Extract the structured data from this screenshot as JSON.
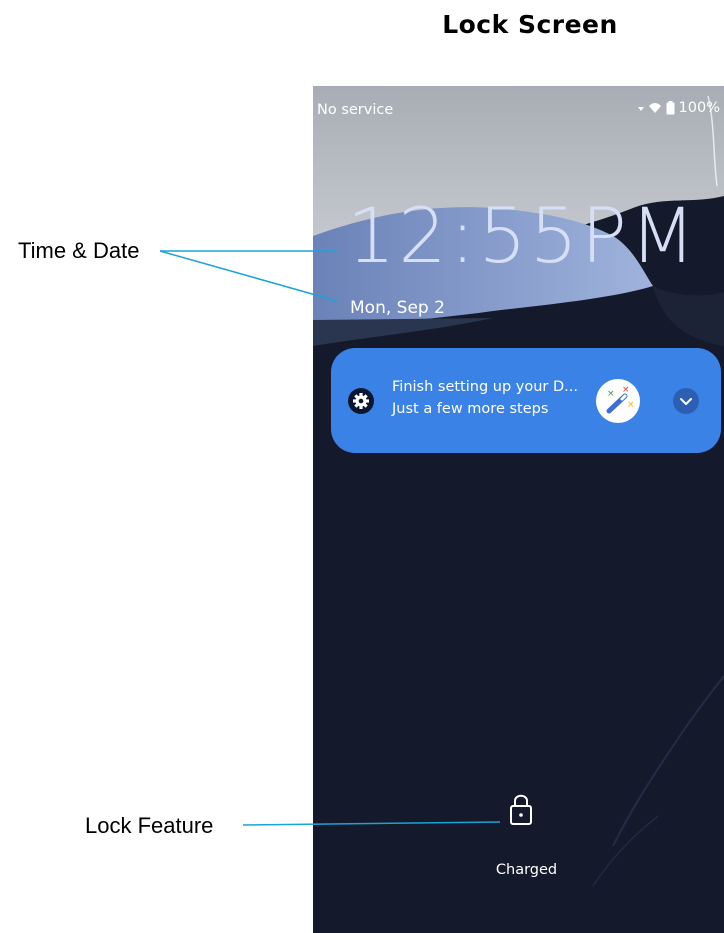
{
  "document": {
    "title": "Lock Screen"
  },
  "callouts": [
    {
      "label": "Time & Date"
    },
    {
      "label": "Lock Feature"
    }
  ],
  "status_bar": {
    "carrier": "No service",
    "battery_percent": "100%",
    "icons": [
      "wifi-icon",
      "battery-icon"
    ]
  },
  "lock_screen": {
    "time": "12:55PM",
    "date": "Mon, Sep 2",
    "status_text": "Charged"
  },
  "notification": {
    "title": "Finish setting up your D...",
    "text": "Just a few more steps",
    "app_icon": "settings-gear-icon",
    "image": "setup-wizard-wand-icon",
    "expand_icon": "chevron-down-icon"
  },
  "colors": {
    "notification_bg": "#3b82e6",
    "clock_text": "#d7dff7",
    "callout_line": "#1aa3d9",
    "wallpaper_dark": "#141a2b"
  }
}
